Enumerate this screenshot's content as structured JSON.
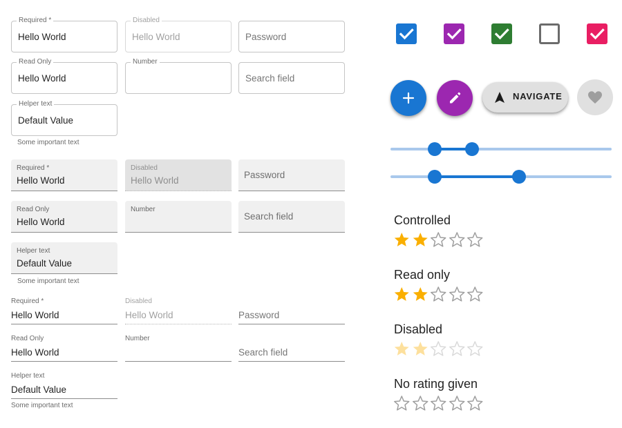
{
  "colors": {
    "primary": "#1976d2",
    "secondary": "#9c27b0",
    "success": "#2e7d32",
    "error": "#e91e63",
    "star": "#faaf00"
  },
  "outlined": {
    "required": {
      "label": "Required *",
      "value": "Hello World"
    },
    "disabled": {
      "label": "Disabled",
      "value": "Hello World"
    },
    "password": {
      "placeholder": "Password"
    },
    "readonly": {
      "label": "Read Only",
      "value": "Hello World"
    },
    "number": {
      "label": "Number"
    },
    "search": {
      "placeholder": "Search field"
    },
    "helper": {
      "label": "Helper text",
      "value": "Default Value",
      "helper_text": "Some important text"
    }
  },
  "filled": {
    "required": {
      "label": "Required *",
      "value": "Hello World"
    },
    "disabled": {
      "label": "Disabled",
      "value": "Hello World"
    },
    "password": {
      "placeholder": "Password"
    },
    "readonly": {
      "label": "Read Only",
      "value": "Hello World"
    },
    "number": {
      "label": "Number"
    },
    "search": {
      "placeholder": "Search field"
    },
    "helper": {
      "label": "Helper text",
      "value": "Default Value",
      "helper_text": "Some important text"
    }
  },
  "standard": {
    "required": {
      "label": "Required *",
      "value": "Hello World"
    },
    "disabled": {
      "label": "Disabled",
      "value": "Hello World"
    },
    "password": {
      "placeholder": "Password"
    },
    "readonly": {
      "label": "Read Only",
      "value": "Hello World"
    },
    "number": {
      "label": "Number"
    },
    "search": {
      "placeholder": "Search field"
    },
    "helper": {
      "label": "Helper text",
      "value": "Default Value",
      "helper_text": "Some important text"
    }
  },
  "checkboxes": [
    {
      "checked": true,
      "color": "#1976d2"
    },
    {
      "checked": true,
      "color": "#9c27b0"
    },
    {
      "checked": true,
      "color": "#2e7d32"
    },
    {
      "checked": false,
      "color": "#6b6b6b"
    },
    {
      "checked": true,
      "color": "#e91e63"
    }
  ],
  "fabs": {
    "add": {
      "icon": "plus-icon",
      "color": "#1976d2"
    },
    "edit": {
      "icon": "pencil-icon",
      "color": "#9c27b0"
    },
    "navigate": {
      "icon": "navigation-arrow-icon",
      "label": "NAVIGATE"
    },
    "favorite": {
      "icon": "heart-icon",
      "disabled": true
    }
  },
  "sliders": [
    {
      "range": [
        20,
        37
      ]
    },
    {
      "range": [
        20,
        58
      ]
    }
  ],
  "ratings": {
    "controlled": {
      "title": "Controlled",
      "value": 2,
      "max": 5
    },
    "readonly": {
      "title": "Read only",
      "value": 2,
      "max": 5
    },
    "disabled": {
      "title": "Disabled",
      "value": 2,
      "max": 5
    },
    "none": {
      "title": "No rating given",
      "value": 0,
      "max": 5
    }
  }
}
